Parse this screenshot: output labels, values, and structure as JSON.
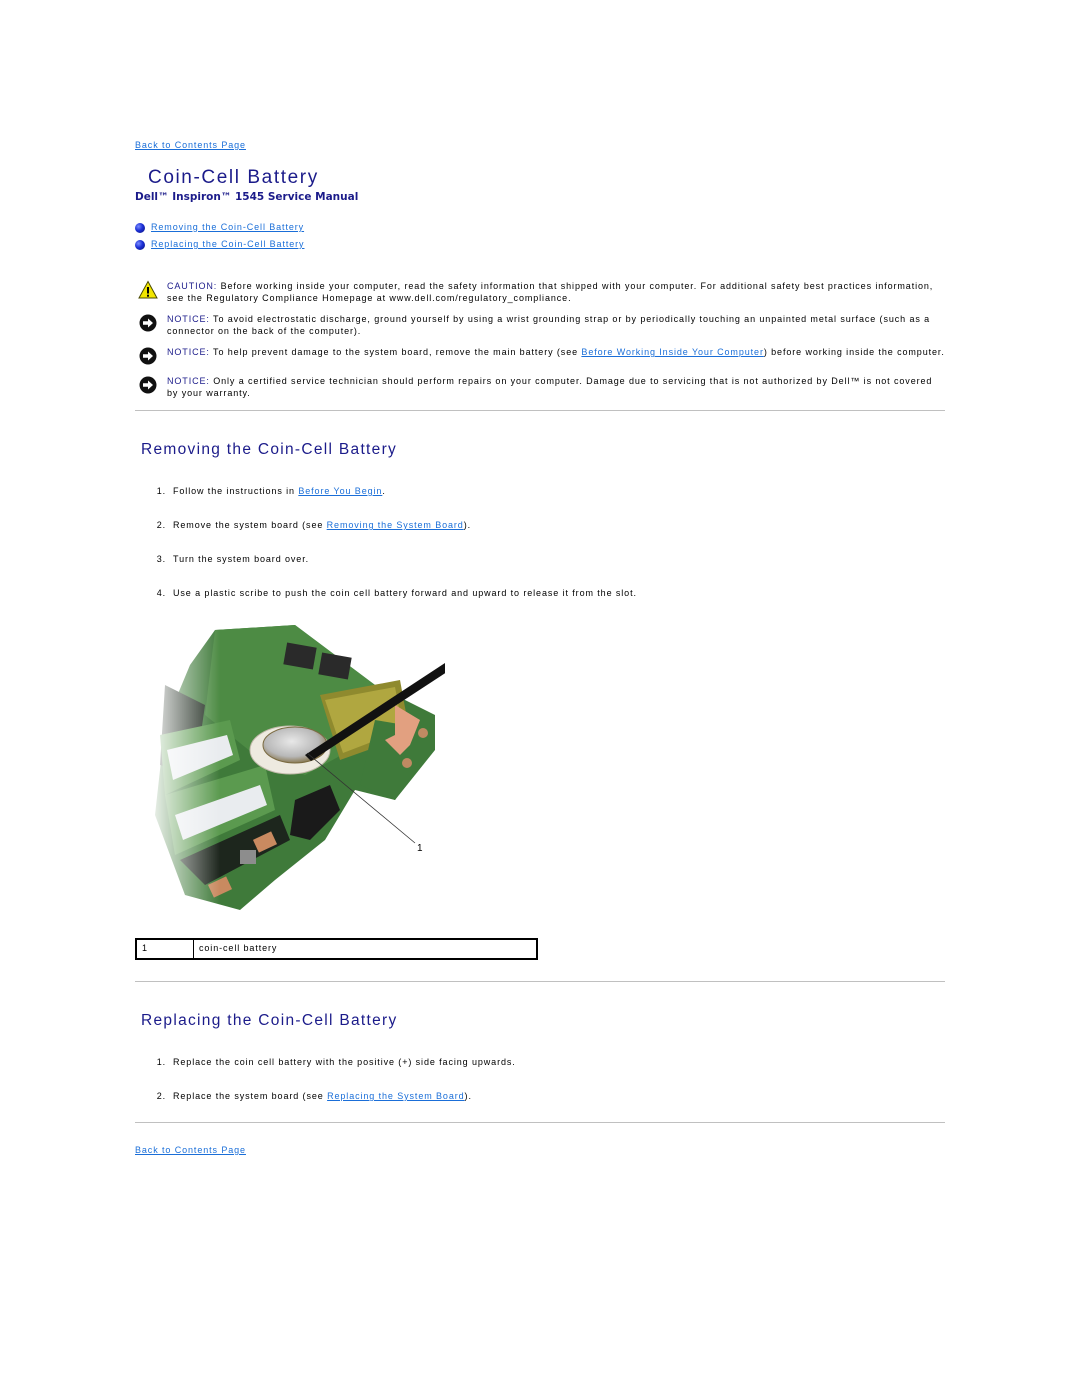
{
  "nav": {
    "back_to_contents_top": "Back to Contents Page",
    "back_to_contents_bottom": "Back to Contents Page"
  },
  "header": {
    "title": "Coin-Cell Battery",
    "manual_title": "Dell™ Inspiron™ 1545 Service Manual"
  },
  "toc": [
    {
      "label": "Removing the Coin-Cell Battery",
      "icon": "blue-bullet-icon"
    },
    {
      "label": "Replacing the Coin-Cell Battery",
      "icon": "blue-bullet-icon"
    }
  ],
  "notices": [
    {
      "type": "caution",
      "icon": "warning-triangle-icon",
      "label": "CAUTION:",
      "text_before": " Before working inside your computer, read the safety information that shipped with your computer. For additional safety best practices information, see the Regulatory Compliance Homepage at www.dell.com/regulatory_compliance.",
      "link": "",
      "text_after": ""
    },
    {
      "type": "notice",
      "icon": "notice-arrow-icon",
      "label": "NOTICE:",
      "text_before": " To avoid electrostatic discharge, ground yourself by using a wrist grounding strap or by periodically touching an unpainted metal surface (such as a connector on the back of the computer).",
      "link": "",
      "text_after": ""
    },
    {
      "type": "notice",
      "icon": "notice-arrow-icon",
      "label": "NOTICE:",
      "text_before": " To help prevent damage to the system board, remove the main battery (see ",
      "link": "Before Working Inside Your Computer",
      "text_after": ") before working inside the computer."
    },
    {
      "type": "notice",
      "icon": "notice-arrow-icon",
      "label": "NOTICE:",
      "text_before": " Only a certified service technician should perform repairs on your computer. Damage due to servicing that is not authorized by Dell™ is not covered by your warranty.",
      "link": "",
      "text_after": ""
    }
  ],
  "removing": {
    "heading": "Removing the Coin-Cell Battery",
    "steps": [
      {
        "num": "1.",
        "text_before": "Follow the instructions in ",
        "link": "Before You Begin",
        "text_after": "."
      },
      {
        "num": "2.",
        "text_before": "Remove the system board (see ",
        "link": "Removing the System Board",
        "text_after": ")."
      },
      {
        "num": "3.",
        "text_before": "Turn the system board over.",
        "link": "",
        "text_after": ""
      },
      {
        "num": "4.",
        "text_before": "Use a plastic scribe to push the coin cell battery forward and upward to release it from the slot.",
        "link": "",
        "text_after": ""
      }
    ],
    "figure": {
      "callout_number": "1"
    },
    "callout_table": [
      {
        "number": "1",
        "label": "coin-cell battery"
      }
    ]
  },
  "replacing": {
    "heading": "Replacing the Coin-Cell Battery",
    "steps": [
      {
        "num": "1.",
        "text_before": "Replace the coin cell battery with the positive (+) side facing upwards.",
        "link": "",
        "text_after": ""
      },
      {
        "num": "2.",
        "text_before": "Replace the system board (see ",
        "link": "Replacing the System Board",
        "text_after": ")."
      }
    ]
  },
  "colors": {
    "heading": "#1b1b8a",
    "link": "#1a6ed8",
    "separator": "#c0c0c0"
  }
}
